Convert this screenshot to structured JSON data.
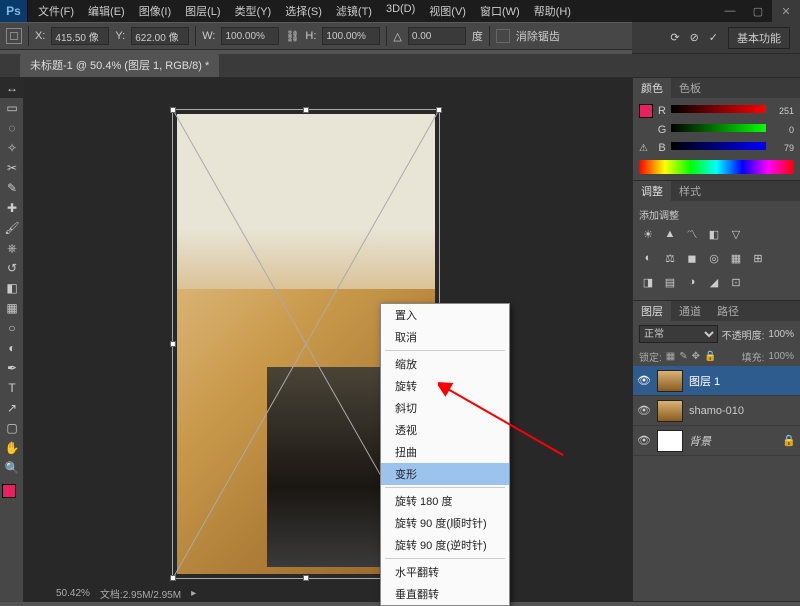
{
  "app": {
    "logo": "Ps"
  },
  "menu": [
    "文件(F)",
    "编辑(E)",
    "图像(I)",
    "图层(L)",
    "类型(Y)",
    "选择(S)",
    "滤镜(T)",
    "3D(D)",
    "视图(V)",
    "窗口(W)",
    "帮助(H)"
  ],
  "options": {
    "x_label": "X:",
    "x_value": "415.50 像",
    "y_label": "Y:",
    "y_value": "622.00 像",
    "w_label": "W:",
    "w_value": "100.00%",
    "h_label": "H:",
    "h_value": "100.00%",
    "angle_label": "△",
    "angle_value": "0.00",
    "deg": "度",
    "interp": "消除锯齿"
  },
  "workspace_btn": "基本功能",
  "tab": {
    "title": "未标题-1 @ 50.4% (图层 1, RGB/8) *"
  },
  "status": {
    "zoom": "50.42%",
    "docinfo": "文档:2.95M/2.95M"
  },
  "panels": {
    "color_tab": "颜色",
    "swatches_tab": "色板",
    "r_label": "R",
    "r_val": "251",
    "g_label": "G",
    "g_val": "0",
    "b_label": "B",
    "b_val": "79",
    "adjust_tab": "调整",
    "styles_tab": "样式",
    "adjust_title": "添加调整",
    "layers_tab": "图层",
    "channels_tab": "通道",
    "paths_tab": "路径",
    "blend_mode": "正常",
    "opacity_label": "不透明度:",
    "opacity_val": "100%",
    "lock_label": "锁定:",
    "fill_label": "填充:",
    "fill_val": "100%"
  },
  "layers": [
    {
      "name": "图层 1"
    },
    {
      "name": "shamo-010"
    },
    {
      "name": "背景"
    }
  ],
  "context_menu": {
    "items": [
      {
        "label": "置入",
        "sep": false
      },
      {
        "label": "取消",
        "sep": true
      },
      {
        "label": "缩放",
        "sep": false
      },
      {
        "label": "旋转",
        "sep": false
      },
      {
        "label": "斜切",
        "sep": false
      },
      {
        "label": "透视",
        "sep": false
      },
      {
        "label": "扭曲",
        "sep": false
      },
      {
        "label": "变形",
        "sep": true,
        "hl": true
      },
      {
        "label": "旋转 180 度",
        "sep": false
      },
      {
        "label": "旋转 90 度(顺时针)",
        "sep": false
      },
      {
        "label": "旋转 90 度(逆时针)",
        "sep": true
      },
      {
        "label": "水平翻转",
        "sep": false
      },
      {
        "label": "垂直翻转",
        "sep": false
      }
    ]
  }
}
